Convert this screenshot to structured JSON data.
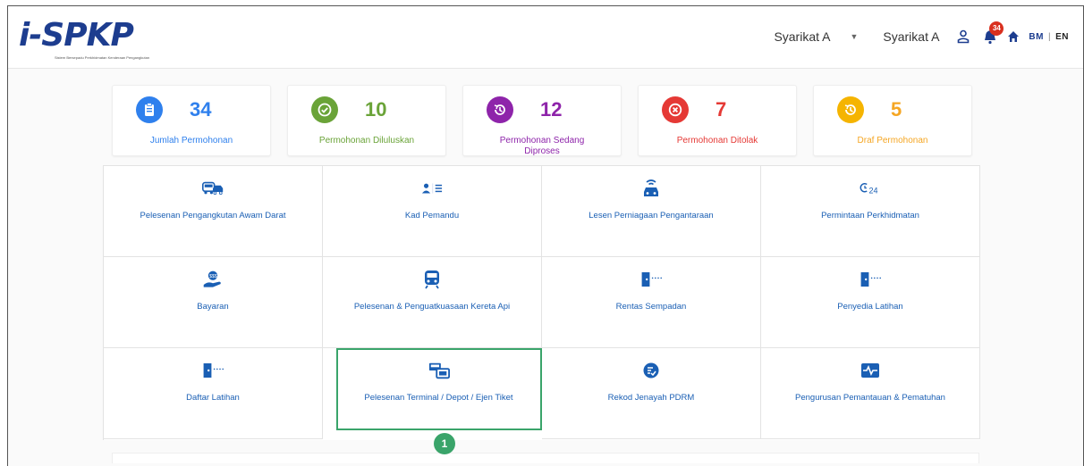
{
  "header": {
    "logo_text": "i-SPKP",
    "logo_subtitle": "Sistem Bersepadu Perkhidmatan Kenderaan Pengangkutan",
    "company_selected": "Syarikat A",
    "company_name": "Syarikat A",
    "notification_count": "34",
    "lang_bm": "BM",
    "lang_sep": "|",
    "lang_en": "EN",
    "icons": [
      "user-icon",
      "bell-icon",
      "home-icon",
      "caret-down-icon"
    ]
  },
  "stats": [
    {
      "value": "34",
      "label": "Jumlah Permohonan",
      "color": "#2f80ed",
      "icon": "clipboard-icon"
    },
    {
      "value": "10",
      "label": "Permohonan Diluluskan",
      "color": "#6aa338",
      "icon": "check-icon"
    },
    {
      "value": "12",
      "label": "Permohonan Sedang Diproses",
      "color": "#8e24aa",
      "icon": "history-icon"
    },
    {
      "value": "7",
      "label": "Permohonan Ditolak",
      "color": "#e53935",
      "icon": "cancel-icon"
    },
    {
      "value": "5",
      "label": "Draf Permohonan",
      "color": "#f5a623",
      "icon": "history-icon"
    }
  ],
  "services": [
    {
      "label": "Pelesenan Pengangkutan Awam Darat",
      "icon": "bus-car-icon"
    },
    {
      "label": "Kad Pemandu",
      "icon": "driver-card-icon"
    },
    {
      "label": "Lesen Perniagaan Pengantaraan",
      "icon": "connected-car-icon"
    },
    {
      "label": "Permintaan Perkhidmatan",
      "icon": "service-24-icon"
    },
    {
      "label": "Bayaran",
      "icon": "payment-hand-icon"
    },
    {
      "label": "Pelesenan & Penguatkuasaan Kereta Api",
      "icon": "train-icon"
    },
    {
      "label": "Rentas Sempadan",
      "icon": "border-door-icon"
    },
    {
      "label": "Penyedia Latihan",
      "icon": "training-door-icon"
    },
    {
      "label": "Daftar Latihan",
      "icon": "register-door-icon"
    },
    {
      "label": "Pelesenan Terminal / Depot / Ejen Tiket",
      "icon": "terminal-ticket-icon"
    },
    {
      "label": "Rekod Jenayah PDRM",
      "icon": "record-icon"
    },
    {
      "label": "Pengurusan Pemantauan & Pematuhan",
      "icon": "monitor-pulse-icon"
    }
  ],
  "step_marker": "1",
  "accent_color": "#1a5fb4",
  "highlight_color": "#3aa46a"
}
